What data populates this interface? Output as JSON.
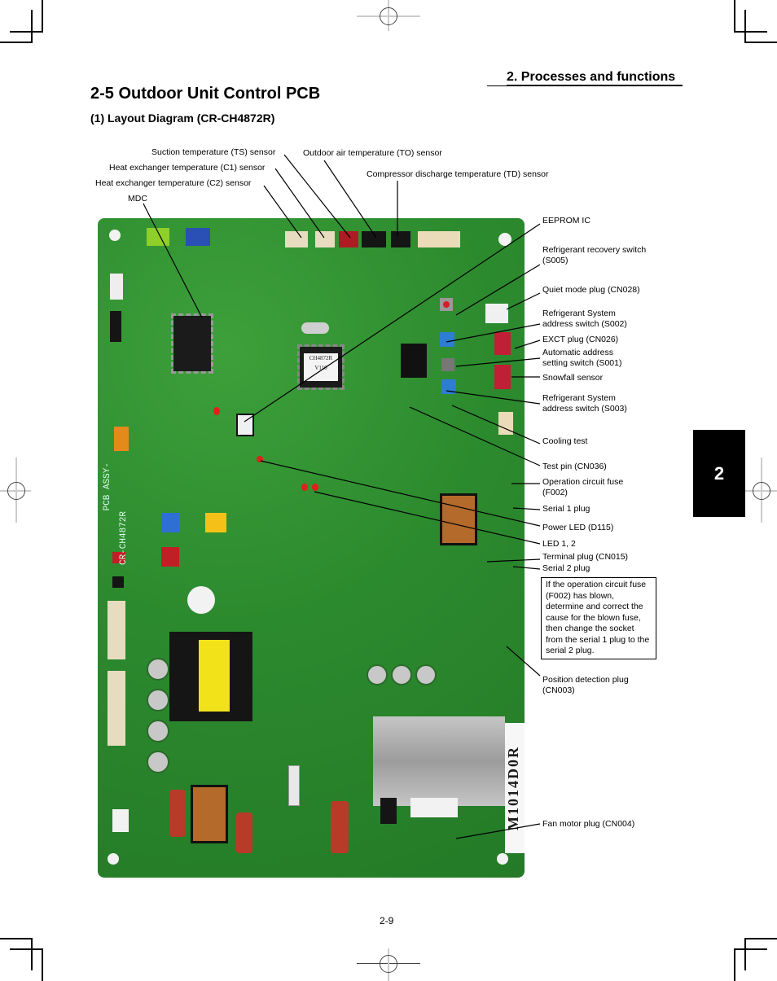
{
  "header": {
    "section": "2. Processes and functions",
    "title": "2-5  Outdoor Unit Control PCB",
    "subtitle": "(1) Layout Diagram (CR-CH4872R)"
  },
  "chapter_tab": "2",
  "labels_top": {
    "suction": "Suction temperature (TS) sensor",
    "outdoor_air": "Outdoor air temperature (TO) sensor",
    "hx_c1": "Heat exchanger temperature (C1) sensor",
    "discharge": "Compressor discharge temperature (TD) sensor",
    "hx_c2": "Heat exchanger temperature (C2) sensor",
    "mdc": "MDC"
  },
  "labels_right": [
    {
      "text": "EEPROM IC"
    },
    {
      "text": "Refrigerant recovery switch\n(S005)"
    },
    {
      "text": "Quiet mode plug (CN028)"
    },
    {
      "text": "Refrigerant System\naddress switch (S002)"
    },
    {
      "text": "EXCT plug (CN026)"
    },
    {
      "text": "Automatic address\nsetting switch (S001)"
    },
    {
      "text": "Snowfall sensor"
    },
    {
      "text": "Refrigerant System\naddress switch (S003)"
    },
    {
      "text": "Cooling test"
    },
    {
      "text": "Test pin (CN036)"
    },
    {
      "text": "Operation circuit fuse\n(F002)"
    },
    {
      "text": "Serial 1 plug"
    },
    {
      "text": "Power LED (D115)"
    },
    {
      "text": "LED 1, 2"
    },
    {
      "text": "Terminal plug (CN015)"
    },
    {
      "text": "Serial 2 plug"
    },
    {
      "text": "Position detection plug\n(CN003)"
    },
    {
      "text": "Fan motor plug (CN004)"
    }
  ],
  "note": "If the operation circuit fuse (F002) has blown, determine and correct the cause for the blown fuse, then change the socket from the serial 1 plug to the serial 2 plug.",
  "pcb": {
    "chip_label_1": "CH4872R",
    "chip_label_2": "V110",
    "board_id": "CR-CH4872R",
    "serial_print": "M1014D0R",
    "assy": "PCB ASSY-"
  },
  "page_number": "2-9",
  "colors": {
    "board_green": "#2f8a2f",
    "tab_black": "#000000"
  }
}
